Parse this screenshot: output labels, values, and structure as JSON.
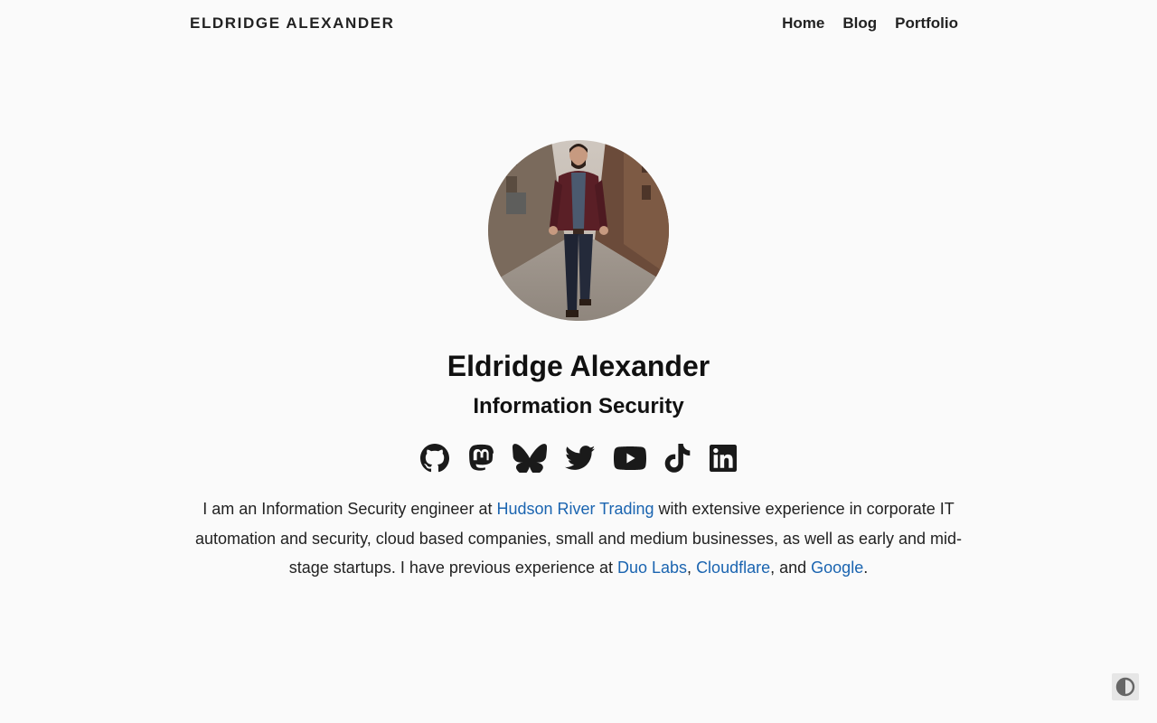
{
  "header": {
    "site_title": "ELDRIDGE ALEXANDER",
    "nav": [
      {
        "label": "Home"
      },
      {
        "label": "Blog"
      },
      {
        "label": "Portfolio"
      }
    ]
  },
  "profile": {
    "name": "Eldridge Alexander",
    "subtitle": "Information Security"
  },
  "social_links": [
    {
      "icon": "github-icon"
    },
    {
      "icon": "mastodon-icon"
    },
    {
      "icon": "bluesky-icon"
    },
    {
      "icon": "twitter-icon"
    },
    {
      "icon": "youtube-icon"
    },
    {
      "icon": "tiktok-icon"
    },
    {
      "icon": "linkedin-icon"
    }
  ],
  "bio": {
    "part1": "I am an Information Security engineer at ",
    "link1": "Hudson River Trading",
    "part2": " with extensive experience in corporate IT automation and security, cloud based companies, small and medium businesses, as well as early and mid-stage startups. I have previous experience at ",
    "link2": "Duo Labs",
    "sep1": ", ",
    "link3": "Cloudflare",
    "sep2": ", and ",
    "link4": "Google",
    "end": "."
  },
  "theme_toggle": {
    "icon": "contrast-icon"
  },
  "colors": {
    "background": "#fafafa",
    "text": "#222222",
    "link": "#1a64b0"
  }
}
